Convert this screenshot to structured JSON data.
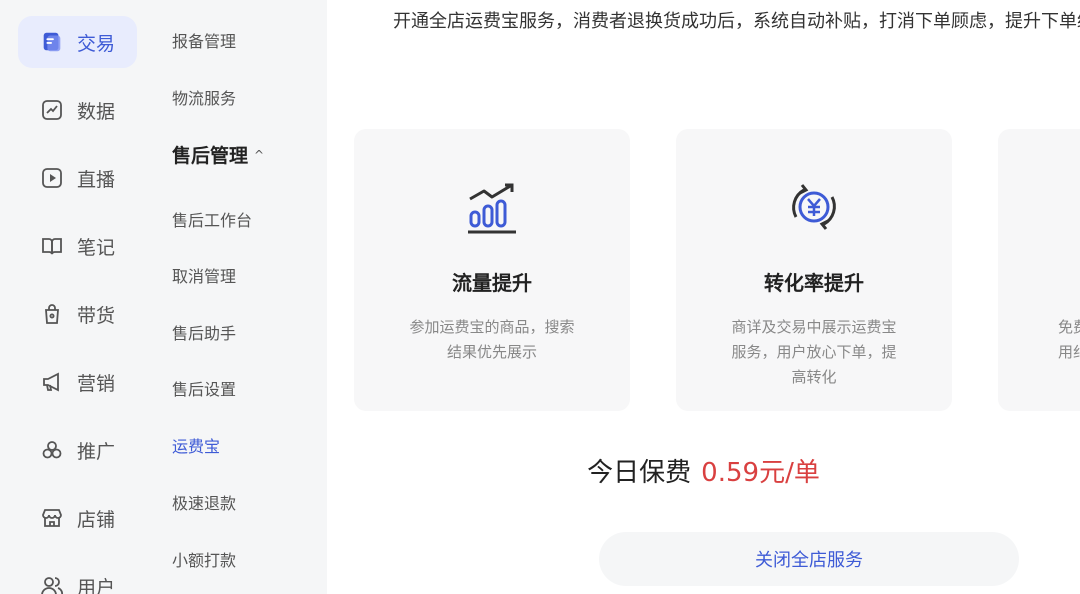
{
  "nav": {
    "items": [
      {
        "label": "交易",
        "icon": "trade-doc-icon",
        "active": true
      },
      {
        "label": "数据",
        "icon": "trend-chart-icon"
      },
      {
        "label": "直播",
        "icon": "play-icon"
      },
      {
        "label": "笔记",
        "icon": "book-icon"
      },
      {
        "label": "带货",
        "icon": "bag-icon"
      },
      {
        "label": "营销",
        "icon": "megaphone-icon"
      },
      {
        "label": "推广",
        "icon": "circles-icon"
      },
      {
        "label": "店铺",
        "icon": "store-icon"
      },
      {
        "label": "用户",
        "icon": "users-icon"
      }
    ]
  },
  "submenu": {
    "items": [
      {
        "label": "报备管理"
      },
      {
        "label": "物流服务"
      },
      {
        "label": "售后管理",
        "group": true,
        "expanded": true
      },
      {
        "label": "售后工作台"
      },
      {
        "label": "取消管理"
      },
      {
        "label": "售后助手"
      },
      {
        "label": "售后设置"
      },
      {
        "label": "运费宝",
        "active": true
      },
      {
        "label": "极速退款"
      },
      {
        "label": "小额打款"
      }
    ]
  },
  "main": {
    "intro": "开通全店运费宝服务，消费者退换货成功后，系统自动补贴，打消下单顾虑，提升下单纷。",
    "cards": [
      {
        "title": "流量提升",
        "desc": "参加运费宝的商品，搜索结果优先展示",
        "icon": "bar-trend-icon"
      },
      {
        "title": "转化率提升",
        "desc": "商详及交易中展示运费宝服务，用户放心下单，提高转化",
        "icon": "yuan-refresh-icon"
      },
      {
        "title": "",
        "desc": "免费用纠",
        "icon": ""
      }
    ],
    "fee_label": "今日保费",
    "fee_amount": "0.59元/单",
    "close_button": "关闭全店服务"
  },
  "colors": {
    "accent": "#3e5bd6",
    "price": "#d94040"
  }
}
